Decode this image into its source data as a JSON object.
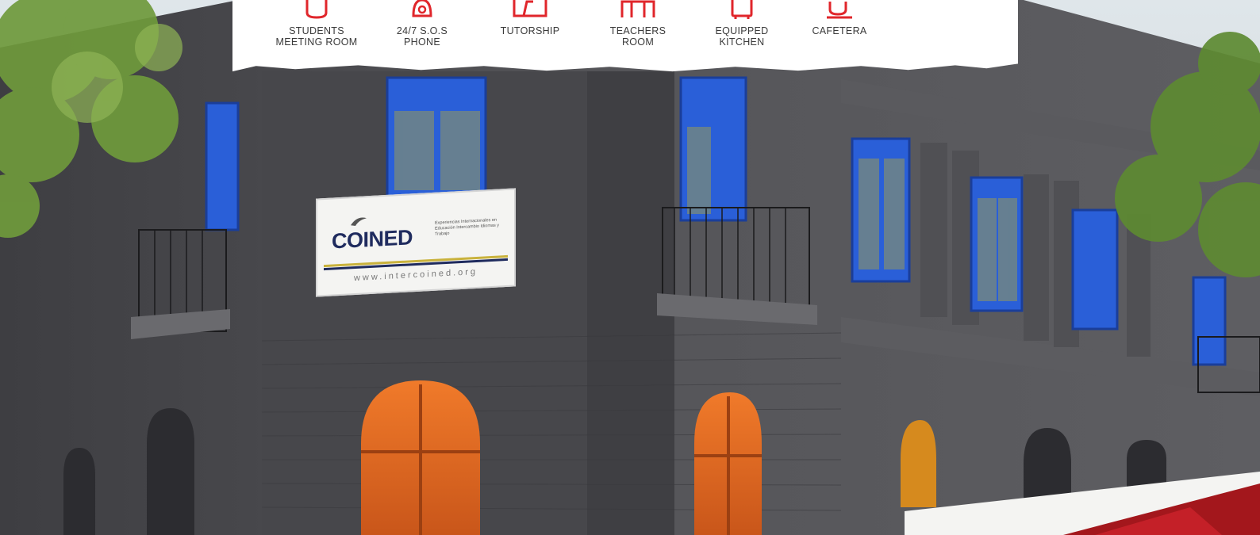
{
  "amenities": [
    {
      "icon": "meeting-room-icon",
      "label": "STUDENTS\nMEETING ROOM"
    },
    {
      "icon": "sos-phone-icon",
      "label": "24/7 S.O.S\nPHONE"
    },
    {
      "icon": "tutorship-icon",
      "label": "TUTORSHIP"
    },
    {
      "icon": "teachers-room-icon",
      "label": "TEACHERS\nROOM"
    },
    {
      "icon": "kitchen-icon",
      "label": "EQUIPPED\nKITCHEN"
    },
    {
      "icon": "cafeteria-icon",
      "label": "CAFETERA"
    }
  ],
  "banner": {
    "brand": "COINED",
    "tagline": "Experiencias Internacionales en Educación Intercambio Idiomas y Trabajo",
    "website": "www.intercoined.org"
  },
  "colors": {
    "accent": "#e0262b",
    "facade": "#4a4a4e",
    "window_frame": "#1f4fd0",
    "door": "#e0641a",
    "foliage": "#6f9a3c"
  }
}
